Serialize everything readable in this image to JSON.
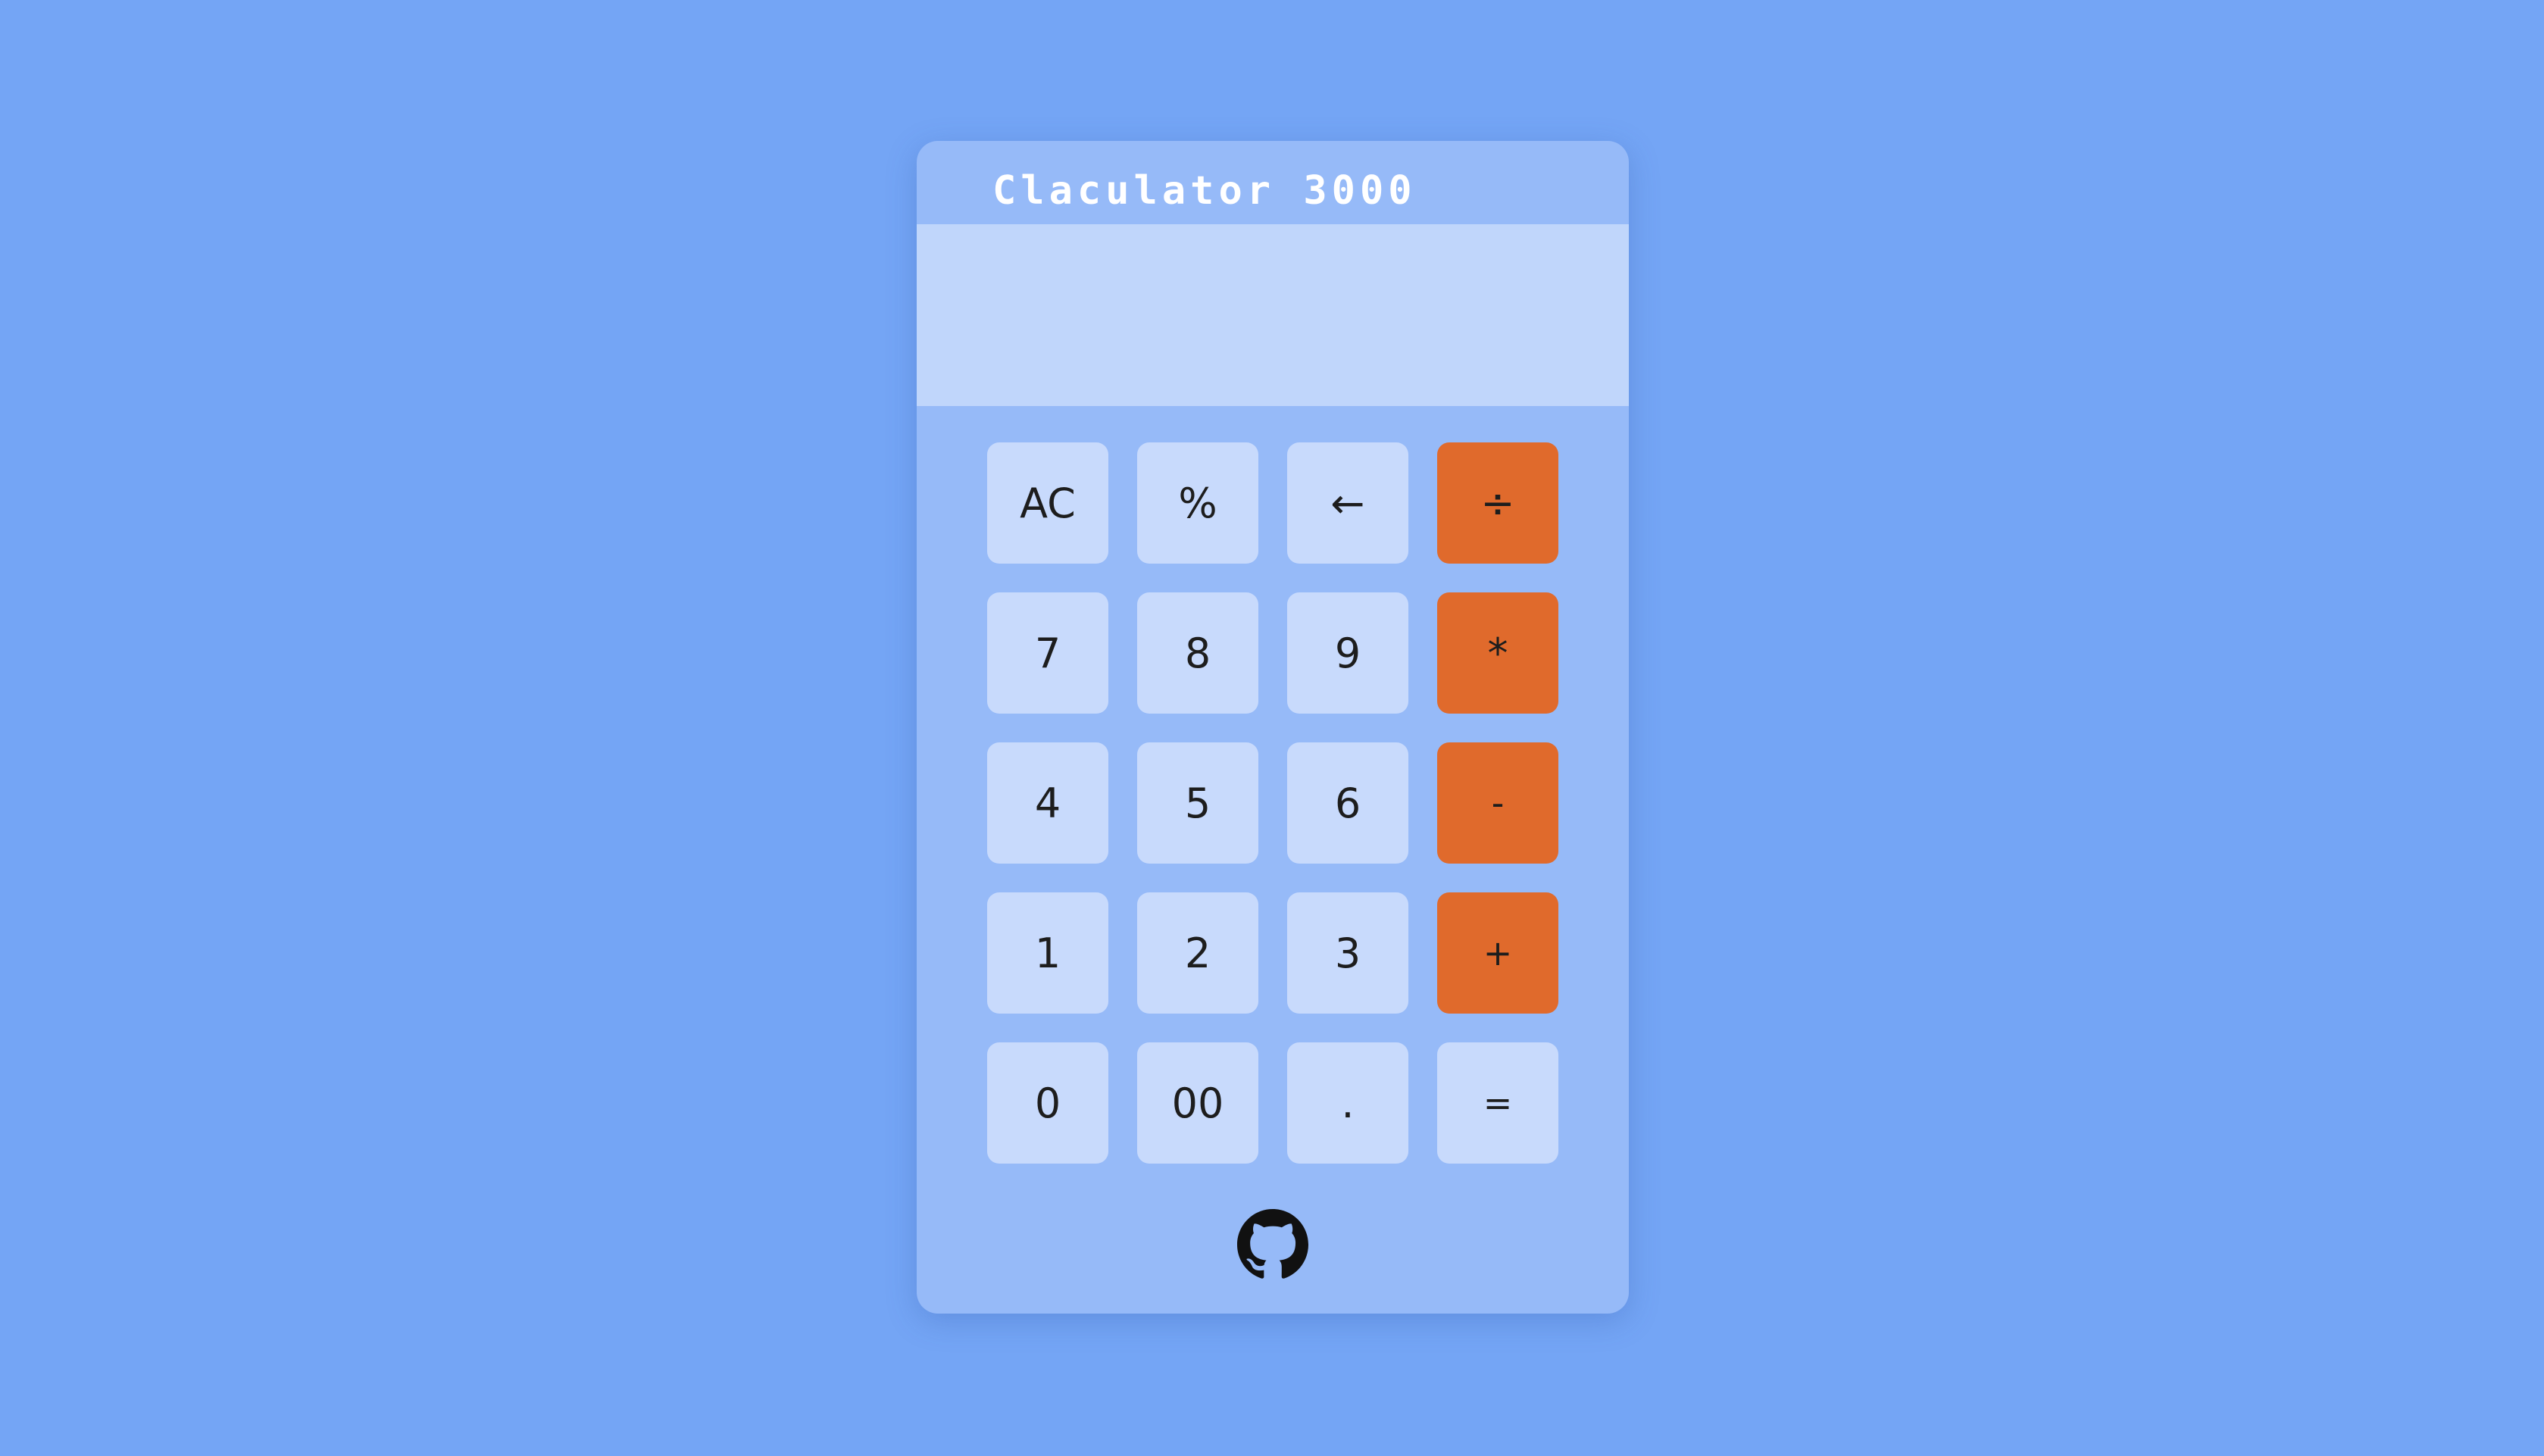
{
  "app": {
    "title": "Claculator 3000"
  },
  "display": {
    "value": ""
  },
  "keys": [
    {
      "label": "AC",
      "kind": "function"
    },
    {
      "label": "%",
      "kind": "function"
    },
    {
      "label": "←",
      "kind": "function"
    },
    {
      "label": "÷",
      "kind": "operator"
    },
    {
      "label": "7",
      "kind": "digit"
    },
    {
      "label": "8",
      "kind": "digit"
    },
    {
      "label": "9",
      "kind": "digit"
    },
    {
      "label": "*",
      "kind": "operator"
    },
    {
      "label": "4",
      "kind": "digit"
    },
    {
      "label": "5",
      "kind": "digit"
    },
    {
      "label": "6",
      "kind": "digit"
    },
    {
      "label": "-",
      "kind": "operator"
    },
    {
      "label": "1",
      "kind": "digit"
    },
    {
      "label": "2",
      "kind": "digit"
    },
    {
      "label": "3",
      "kind": "digit"
    },
    {
      "label": "+",
      "kind": "operator"
    },
    {
      "label": "0",
      "kind": "digit"
    },
    {
      "label": "00",
      "kind": "digit"
    },
    {
      "label": ".",
      "kind": "digit"
    },
    {
      "label": "=",
      "kind": "equals"
    }
  ],
  "footer": {
    "icon": "github-icon"
  },
  "colors": {
    "background": "#74a5f5",
    "panel": "#96baf8",
    "display": "#c0d6fb",
    "key": "#c8dafc",
    "operator_key": "#e06a2c",
    "title_text": "#ffffff"
  }
}
